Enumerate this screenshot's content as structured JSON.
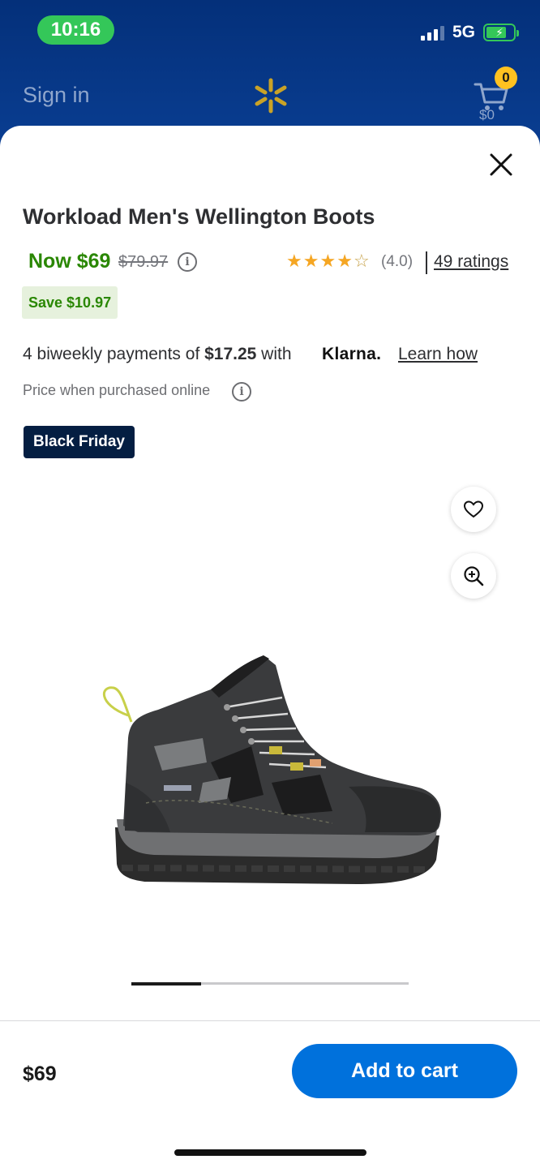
{
  "status_bar": {
    "time": "10:16",
    "network": "5G"
  },
  "header": {
    "signin_label": "Sign in",
    "cart_count": "0",
    "cart_total": "$0",
    "brand_color": "#ffc220"
  },
  "product": {
    "title": "Workload Men's Wellington Boots",
    "price_now": "Now $69",
    "price_was": "$79.97",
    "rating_value": "(4.0)",
    "rating_stars": 4,
    "ratings_link": "49 ratings",
    "save_badge": "Save $10.97",
    "klarna_prefix": "4 biweekly payments of ",
    "klarna_amount": "$17.25",
    "klarna_with": " with",
    "klarna_brand": "Klarna.",
    "learn_how": "Learn how",
    "online_note": "Price when purchased online",
    "badge": "Black Friday"
  },
  "carousel": {
    "current": 1,
    "total": 4
  },
  "footer": {
    "price": "$69",
    "add_to_cart": "Add to cart"
  },
  "colors": {
    "accent_blue": "#0071dc",
    "price_green": "#2a8703",
    "star": "#f5a623",
    "badge_navy": "#041e42"
  },
  "icons": [
    "close-icon",
    "info-icon",
    "star-icon",
    "heart-icon",
    "zoom-in-icon",
    "cart-icon",
    "spark-icon"
  ]
}
